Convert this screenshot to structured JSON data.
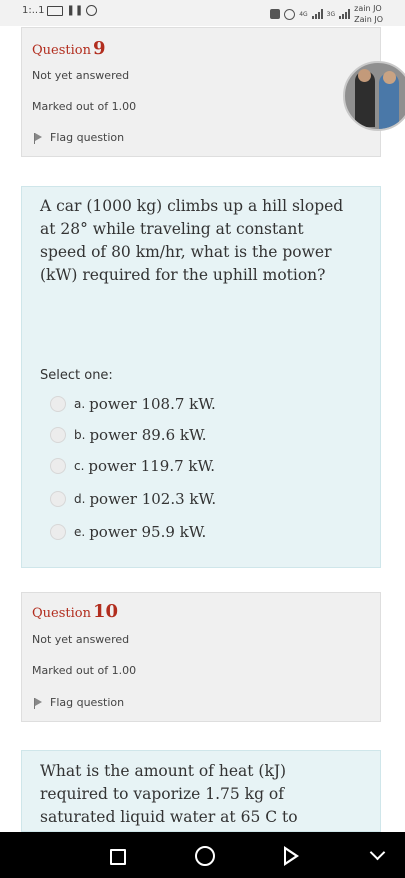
{
  "status_bar": {
    "time": "1:..1",
    "carrier_top": "zain JO",
    "carrier_bottom": "Zain JO",
    "net_a": "4G",
    "net_b": "3G",
    "icons": [
      "battery-icon",
      "pause-icon",
      "alarm-icon",
      "app-icon",
      "circle-icon",
      "signal-icon",
      "signal-icon"
    ]
  },
  "q9": {
    "label": "Question",
    "number": "9",
    "status": "Not yet answered",
    "marks": "Marked out of 1.00",
    "flag_label": "Flag question",
    "text": "A car (1000 kg) climbs up a hill sloped at 28° while traveling at constant speed of 80 km/hr, what is the power (kW) required for the uphill motion?",
    "select_label": "Select one:",
    "options": [
      {
        "letter": "a.",
        "text": "power 108.7 kW."
      },
      {
        "letter": "b.",
        "text": "power 89.6 kW."
      },
      {
        "letter": "c.",
        "text": "power 119.7 kW."
      },
      {
        "letter": "d.",
        "text": "power 102.3 kW."
      },
      {
        "letter": "e.",
        "text": "power 95.9 kW."
      }
    ]
  },
  "q10": {
    "label": "Question",
    "number": "10",
    "status": "Not yet answered",
    "marks": "Marked out of 1.00",
    "flag_label": "Flag question",
    "text": "What is the amount of heat (kJ) required to vaporize 1.75 kg of saturated liquid water at 65 C to"
  },
  "nav": {
    "icons": [
      "recent-apps-icon",
      "home-icon",
      "back-icon",
      "collapse-chevron-icon"
    ]
  }
}
